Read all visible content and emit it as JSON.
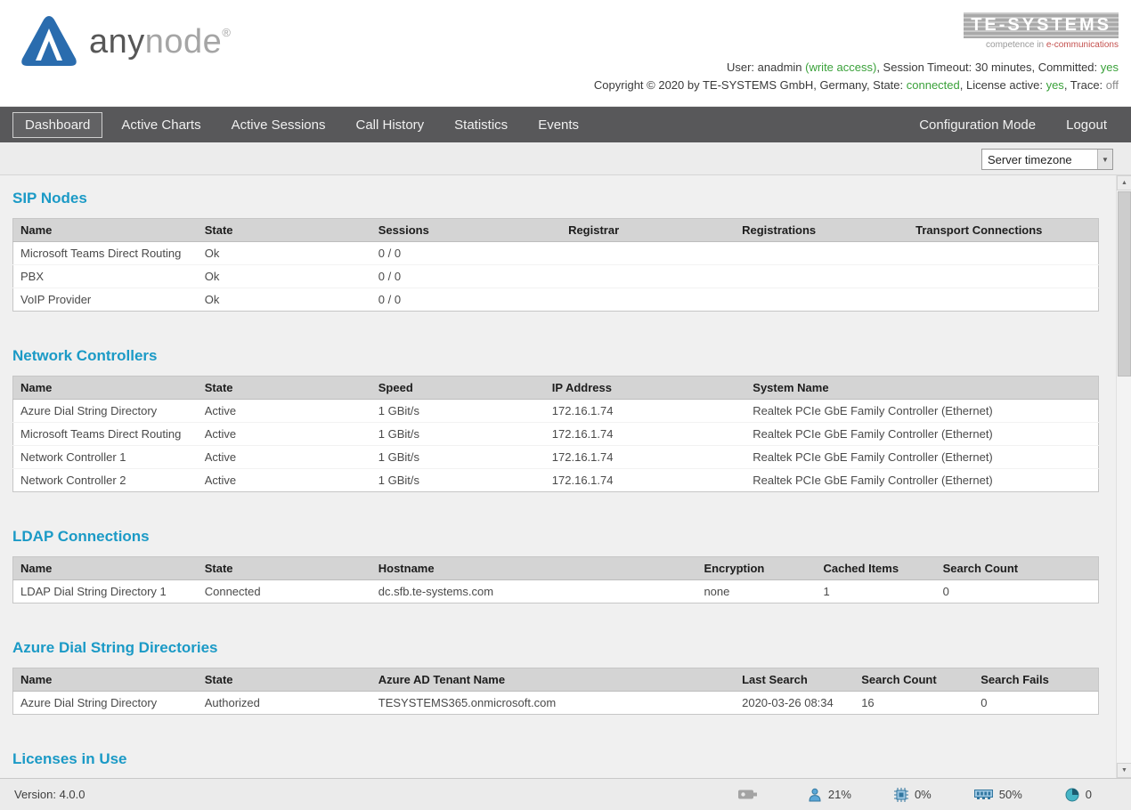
{
  "header": {
    "brand": {
      "any": "any",
      "node": "node",
      "reg": "®"
    },
    "te_logo": {
      "name": "TE-SYSTEMS",
      "tagline_prefix": "competence in ",
      "tagline_accent": "e-communications"
    },
    "info_line1": {
      "pre": "User: anadmin ",
      "write_access": "(write access)",
      "mid": ", Session Timeout: 30 minutes, Committed: ",
      "committed": "yes"
    },
    "info_line2": {
      "pre": "Copyright © 2020 by TE-SYSTEMS GmbH, Germany, State: ",
      "state": "connected",
      "mid": ", License active: ",
      "license": "yes",
      "mid2": ", Trace: ",
      "trace": "off"
    }
  },
  "nav": {
    "items": [
      {
        "label": "Dashboard",
        "active": true
      },
      {
        "label": "Active Charts"
      },
      {
        "label": "Active Sessions"
      },
      {
        "label": "Call History"
      },
      {
        "label": "Statistics"
      },
      {
        "label": "Events"
      }
    ],
    "right": [
      {
        "label": "Configuration Mode"
      },
      {
        "label": "Logout"
      }
    ]
  },
  "toolbar": {
    "timezone": "Server timezone"
  },
  "sections": [
    {
      "title": "SIP Nodes",
      "columns": [
        "Name",
        "State",
        "Sessions",
        "Registrar",
        "Registrations",
        "Transport Connections"
      ],
      "rows": [
        [
          "Microsoft Teams Direct Routing",
          "Ok",
          "0 / 0",
          "",
          "",
          ""
        ],
        [
          "PBX",
          "Ok",
          "0 / 0",
          "",
          "",
          ""
        ],
        [
          "VoIP Provider",
          "Ok",
          "0 / 0",
          "",
          "",
          ""
        ]
      ]
    },
    {
      "title": "Network Controllers",
      "columns": [
        "Name",
        "State",
        "Speed",
        "IP Address",
        "System Name"
      ],
      "rows": [
        [
          "Azure Dial String Directory",
          "Active",
          "1 GBit/s",
          "172.16.1.74",
          "Realtek PCIe GbE Family Controller (Ethernet)"
        ],
        [
          "Microsoft Teams Direct Routing",
          "Active",
          "1 GBit/s",
          "172.16.1.74",
          "Realtek PCIe GbE Family Controller (Ethernet)"
        ],
        [
          "Network Controller 1",
          "Active",
          "1 GBit/s",
          "172.16.1.74",
          "Realtek PCIe GbE Family Controller (Ethernet)"
        ],
        [
          "Network Controller 2",
          "Active",
          "1 GBit/s",
          "172.16.1.74",
          "Realtek PCIe GbE Family Controller (Ethernet)"
        ]
      ]
    },
    {
      "title": "LDAP Connections",
      "columns": [
        "Name",
        "State",
        "Hostname",
        "Encryption",
        "Cached Items",
        "Search Count"
      ],
      "rows": [
        [
          "LDAP Dial String Directory 1",
          "Connected",
          "dc.sfb.te-systems.com",
          "none",
          "1",
          "0"
        ]
      ]
    },
    {
      "title": "Azure Dial String Directories",
      "columns": [
        "Name",
        "State",
        "Azure AD Tenant Name",
        "Last Search",
        "Search Count",
        "Search Fails"
      ],
      "rows": [
        [
          "Azure Dial String Directory",
          "Authorized",
          "TESYSTEMS365.onmicrosoft.com",
          "2020-03-26 08:34",
          "16",
          "0"
        ]
      ]
    },
    {
      "title": "Licenses in Use",
      "columns": [],
      "rows": []
    }
  ],
  "footer": {
    "version": "Version:  4.0.0",
    "meters": [
      {
        "icon": "dongle-icon",
        "value": ""
      },
      {
        "icon": "sessions-icon",
        "value": "21%"
      },
      {
        "icon": "cpu-icon",
        "value": "0%"
      },
      {
        "icon": "memory-icon",
        "value": "50%"
      },
      {
        "icon": "disk-icon",
        "value": "0"
      }
    ]
  },
  "colors": {
    "accent": "#1b9ac6",
    "ok": "#3aa13a",
    "nav_bg": "#58585a"
  }
}
